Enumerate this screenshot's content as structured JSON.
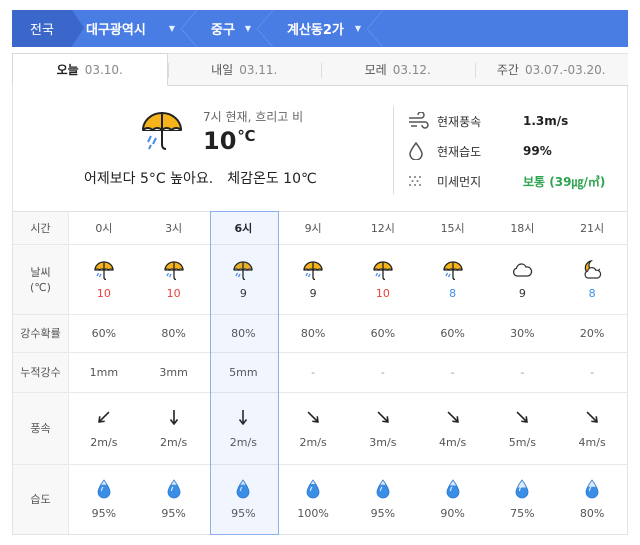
{
  "breadcrumb": {
    "home": "전국",
    "city": "대구광역시",
    "district": "중구",
    "dong": "계산동2가"
  },
  "day_tabs": [
    {
      "label": "오늘",
      "date": "03.10."
    },
    {
      "label": "내일",
      "date": "03.11."
    },
    {
      "label": "모레",
      "date": "03.12."
    },
    {
      "label": "주간",
      "date": "03.07.-03.20."
    }
  ],
  "current": {
    "desc": "7시 현재, 흐리고 비",
    "temp": "10",
    "unit": "℃",
    "compare": "어제보다 5°C 높아요.",
    "feels": "체감온도 10℃",
    "wind_label": "현재풍속",
    "wind_value": "1.3m/s",
    "humid_label": "현재습도",
    "humid_value": "99%",
    "dust_label": "미세먼지",
    "dust_value": "보통 (39㎍/㎥)"
  },
  "table": {
    "labels": {
      "time": "시간",
      "weather": "날씨",
      "weather_unit": "(℃)",
      "precip_prob": "강수확률",
      "precip_amt": "누적강수",
      "wind": "풍속",
      "humidity": "습도"
    },
    "columns": [
      {
        "time": "0시",
        "icon": "umbrella-rain-icon",
        "temp": "10",
        "tcolor": "red",
        "prob": "60%",
        "amt": "1mm",
        "dir": "northeast",
        "wind": "2m/s",
        "hum": "95%",
        "drop": 0.95
      },
      {
        "time": "3시",
        "icon": "umbrella-rain-icon",
        "temp": "10",
        "tcolor": "red",
        "prob": "80%",
        "amt": "3mm",
        "dir": "north",
        "wind": "2m/s",
        "hum": "95%",
        "drop": 0.95
      },
      {
        "time": "6시",
        "icon": "umbrella-rain-icon",
        "temp": "9",
        "tcolor": "normal",
        "prob": "80%",
        "amt": "5mm",
        "dir": "north",
        "wind": "2m/s",
        "hum": "95%",
        "drop": 0.95
      },
      {
        "time": "9시",
        "icon": "umbrella-rain-icon",
        "temp": "9",
        "tcolor": "normal",
        "prob": "80%",
        "amt": "-",
        "dir": "northwest",
        "wind": "2m/s",
        "hum": "100%",
        "drop": 1.0
      },
      {
        "time": "12시",
        "icon": "umbrella-rain-icon",
        "temp": "10",
        "tcolor": "red",
        "prob": "60%",
        "amt": "-",
        "dir": "northwest",
        "wind": "3m/s",
        "hum": "95%",
        "drop": 0.95
      },
      {
        "time": "15시",
        "icon": "umbrella-rain-icon",
        "temp": "8",
        "tcolor": "blue",
        "prob": "60%",
        "amt": "-",
        "dir": "northwest",
        "wind": "4m/s",
        "hum": "90%",
        "drop": 0.9
      },
      {
        "time": "18시",
        "icon": "cloud-icon",
        "temp": "9",
        "tcolor": "normal",
        "prob": "30%",
        "amt": "-",
        "dir": "northwest",
        "wind": "5m/s",
        "hum": "75%",
        "drop": 0.75
      },
      {
        "time": "21시",
        "icon": "moon-cloud-icon",
        "temp": "8",
        "tcolor": "blue",
        "prob": "20%",
        "amt": "-",
        "dir": "northwest",
        "wind": "4m/s",
        "hum": "80%",
        "drop": 0.8
      }
    ]
  },
  "colors": {
    "breadcrumb_bg": "#4a7de3",
    "highlight_border": "#8bb0f0",
    "temp_high": "#e8423a",
    "temp_low": "#3d8fe8",
    "dust_good": "#2ea44f",
    "drop": "#3a8ee6"
  }
}
